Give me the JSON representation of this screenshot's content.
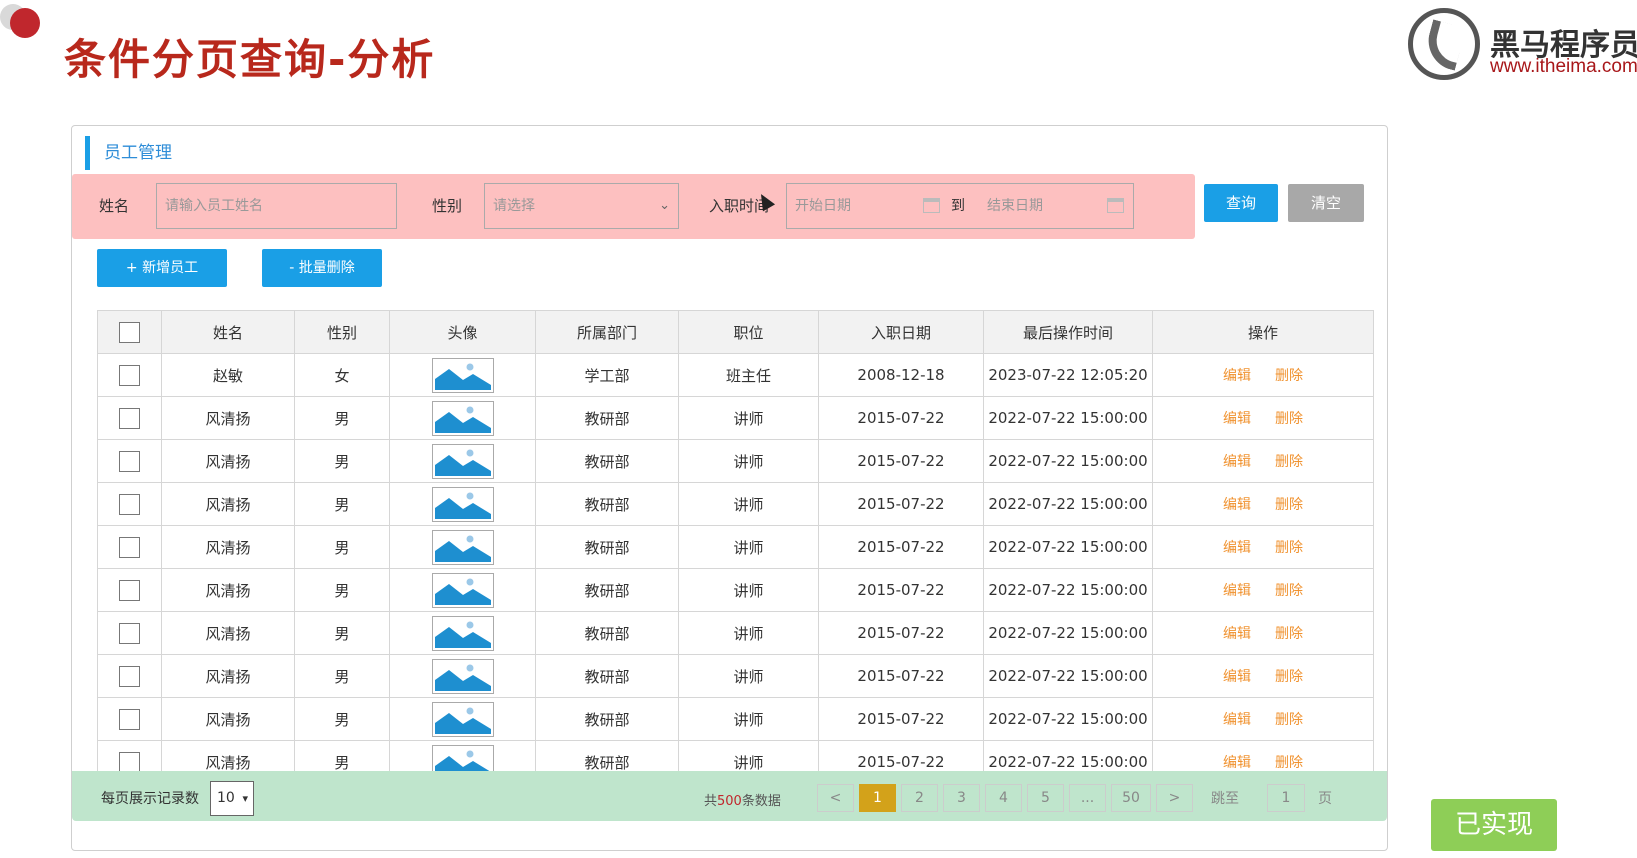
{
  "slide": {
    "title": "条件分页查询-分析"
  },
  "logo": {
    "name": "黑马程序员",
    "url": "www.itheima.com"
  },
  "panel": {
    "header": "员工管理"
  },
  "filters": {
    "name_label": "姓名",
    "name_placeholder": "请输入员工姓名",
    "gender_label": "性别",
    "gender_placeholder": "请选择",
    "date_label": "入职时间",
    "start_placeholder": "开始日期",
    "to_label": "到",
    "end_placeholder": "结束日期"
  },
  "buttons": {
    "query": "查询",
    "clear": "清空",
    "add": "+ 新增员工",
    "batch_delete": "- 批量删除"
  },
  "table": {
    "headers": [
      "姓名",
      "性别",
      "头像",
      "所属部门",
      "职位",
      "入职日期",
      "最后操作时间",
      "操作"
    ],
    "ops": {
      "edit": "编辑",
      "delete": "删除"
    },
    "rows": [
      {
        "name": "赵敏",
        "gender": "女",
        "dept": "学工部",
        "position": "班主任",
        "entry": "2008-12-18",
        "updated": "2023-07-22 12:05:20"
      },
      {
        "name": "风清扬",
        "gender": "男",
        "dept": "教研部",
        "position": "讲师",
        "entry": "2015-07-22",
        "updated": "2022-07-22 15:00:00"
      },
      {
        "name": "风清扬",
        "gender": "男",
        "dept": "教研部",
        "position": "讲师",
        "entry": "2015-07-22",
        "updated": "2022-07-22 15:00:00"
      },
      {
        "name": "风清扬",
        "gender": "男",
        "dept": "教研部",
        "position": "讲师",
        "entry": "2015-07-22",
        "updated": "2022-07-22 15:00:00"
      },
      {
        "name": "风清扬",
        "gender": "男",
        "dept": "教研部",
        "position": "讲师",
        "entry": "2015-07-22",
        "updated": "2022-07-22 15:00:00"
      },
      {
        "name": "风清扬",
        "gender": "男",
        "dept": "教研部",
        "position": "讲师",
        "entry": "2015-07-22",
        "updated": "2022-07-22 15:00:00"
      },
      {
        "name": "风清扬",
        "gender": "男",
        "dept": "教研部",
        "position": "讲师",
        "entry": "2015-07-22",
        "updated": "2022-07-22 15:00:00"
      },
      {
        "name": "风清扬",
        "gender": "男",
        "dept": "教研部",
        "position": "讲师",
        "entry": "2015-07-22",
        "updated": "2022-07-22 15:00:00"
      },
      {
        "name": "风清扬",
        "gender": "男",
        "dept": "教研部",
        "position": "讲师",
        "entry": "2015-07-22",
        "updated": "2022-07-22 15:00:00"
      },
      {
        "name": "风清扬",
        "gender": "男",
        "dept": "教研部",
        "position": "讲师",
        "entry": "2015-07-22",
        "updated": "2022-07-22 15:00:00"
      }
    ]
  },
  "pagination": {
    "per_page_label": "每页展示记录数",
    "per_page_value": "10",
    "total_prefix": "共",
    "total_count": "500",
    "total_suffix": "条数据",
    "prev": "<",
    "pages": [
      "1",
      "2",
      "3",
      "4",
      "5",
      "...",
      "50"
    ],
    "next": ">",
    "jump_label": "跳至",
    "jump_value": "1",
    "page_unit": "页"
  },
  "badge": "已实现",
  "colors": {
    "accent_blue": "#1a9fe6",
    "title_red": "#b8281c",
    "filter_bg": "#fdc0c0",
    "footer_bg": "#bfe5cc",
    "op_orange": "#f0922f",
    "badge_green": "#8ece57"
  }
}
